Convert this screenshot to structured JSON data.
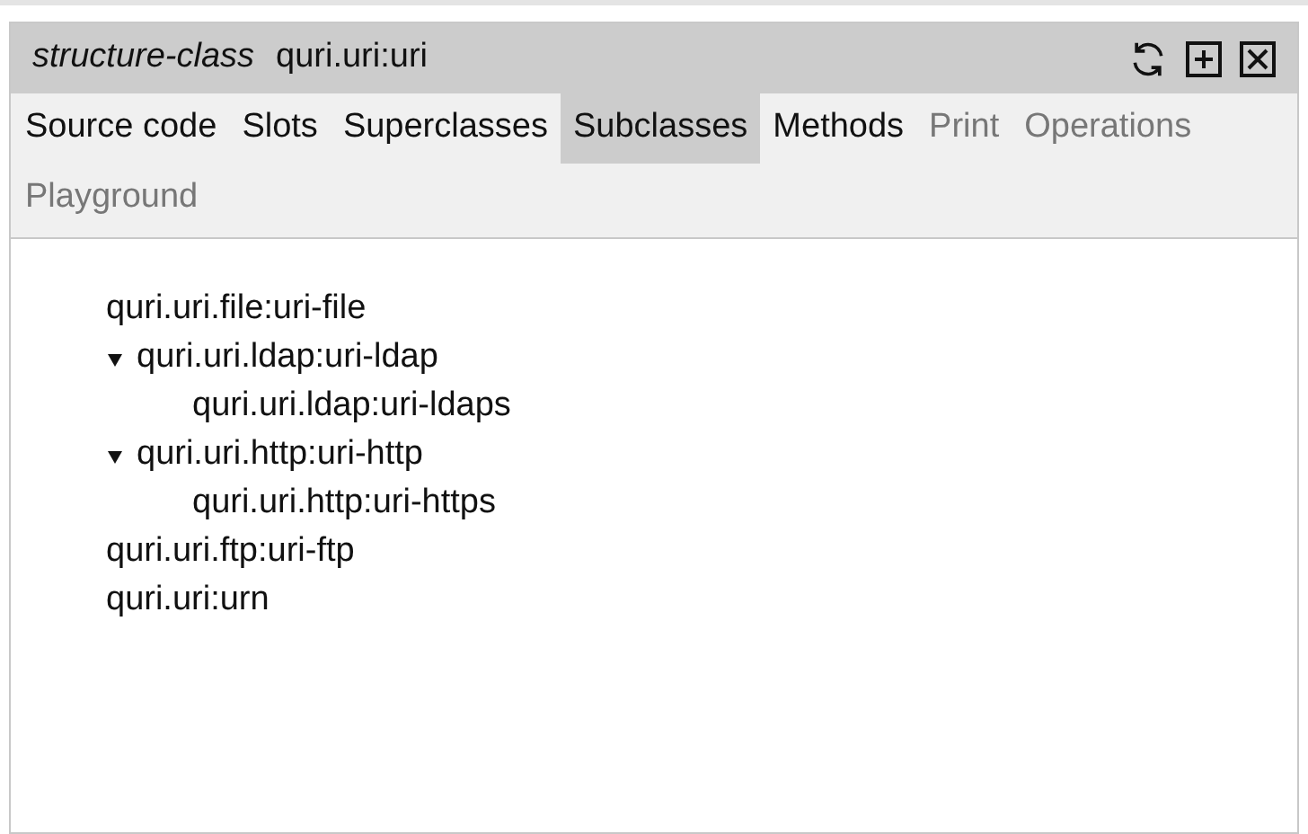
{
  "window": {
    "kind_label": "structure-class",
    "title": "quri.uri:uri"
  },
  "tabs": [
    {
      "label": "Source code",
      "selected": false,
      "disabled": false
    },
    {
      "label": "Slots",
      "selected": false,
      "disabled": false
    },
    {
      "label": "Superclasses",
      "selected": false,
      "disabled": false
    },
    {
      "label": "Subclasses",
      "selected": true,
      "disabled": false
    },
    {
      "label": "Methods",
      "selected": false,
      "disabled": false
    },
    {
      "label": "Print",
      "selected": false,
      "disabled": true
    },
    {
      "label": "Operations",
      "selected": false,
      "disabled": true
    },
    {
      "label": "Playground",
      "selected": false,
      "disabled": true
    }
  ],
  "tree": [
    {
      "label": "quri.uri.file:uri-file"
    },
    {
      "label": "quri.uri.ldap:uri-ldap",
      "expanded": true,
      "children": [
        {
          "label": "quri.uri.ldap:uri-ldaps"
        }
      ]
    },
    {
      "label": "quri.uri.http:uri-http",
      "expanded": true,
      "children": [
        {
          "label": "quri.uri.http:uri-https"
        }
      ]
    },
    {
      "label": "quri.uri.ftp:uri-ftp"
    },
    {
      "label": "quri.uri:urn"
    }
  ]
}
